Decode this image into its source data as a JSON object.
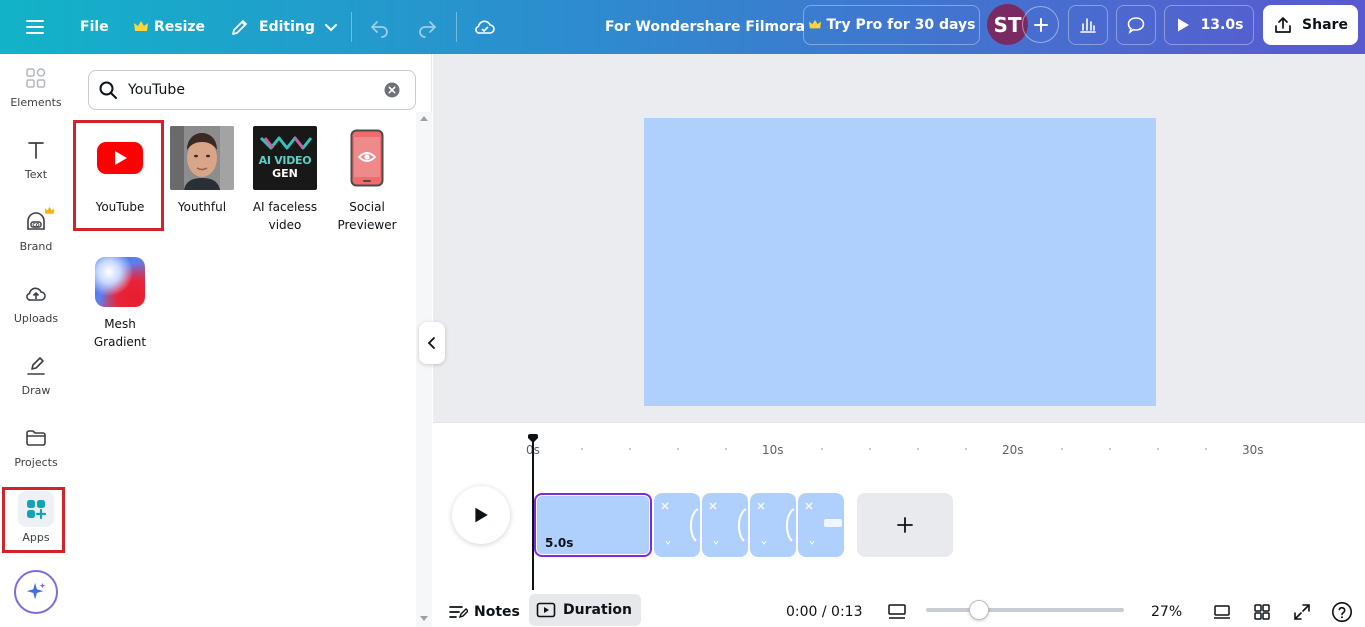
{
  "topbar": {
    "file_label": "File",
    "resize_label": "Resize",
    "editing_label": "Editing",
    "doc_title": "For Wondershare Filmora",
    "try_pro_label": "Try Pro for 30 days",
    "avatar_initials": "ST",
    "play_duration": "13.0s",
    "share_label": "Share",
    "icons": [
      "menu-icon",
      "crown-icon",
      "pencil-icon",
      "chevron-down-icon",
      "undo-icon",
      "redo-icon",
      "cloud-icon",
      "plus-icon",
      "bar-chart-icon",
      "comment-icon",
      "play-icon",
      "share-icon"
    ]
  },
  "rail": {
    "items": [
      {
        "label": "Elements",
        "icon": "shapes-icon"
      },
      {
        "label": "Text",
        "icon": "text-icon"
      },
      {
        "label": "Brand",
        "icon": "brand-icon"
      },
      {
        "label": "Uploads",
        "icon": "cloud-upload-icon"
      },
      {
        "label": "Draw",
        "icon": "pen-icon"
      },
      {
        "label": "Projects",
        "icon": "folder-icon"
      },
      {
        "label": "Apps",
        "icon": "apps-icon"
      }
    ]
  },
  "search": {
    "value": "YouTube"
  },
  "apps": [
    {
      "label": "YouTube"
    },
    {
      "label": "Youthful"
    },
    {
      "label": "AI faceless video",
      "logo_text_1": "AI VIDEO",
      "logo_text_2": "GEN"
    },
    {
      "label": "Social Previewer"
    },
    {
      "label": "Mesh Gradient"
    }
  ],
  "timeline": {
    "ticks": [
      "0s",
      "10s",
      "20s",
      "30s"
    ],
    "first_clip_duration": "5.0s",
    "notes_label": "Notes",
    "duration_label": "Duration",
    "time_readout": "0:00 / 0:13",
    "zoom": "27%",
    "zoom_fraction": 0.27
  },
  "colors": {
    "page_fill": "#afd0fc",
    "accent_purple": "#7d2ae8",
    "highlight_red": "#d3232a",
    "youtube_red": "#ff0000"
  }
}
